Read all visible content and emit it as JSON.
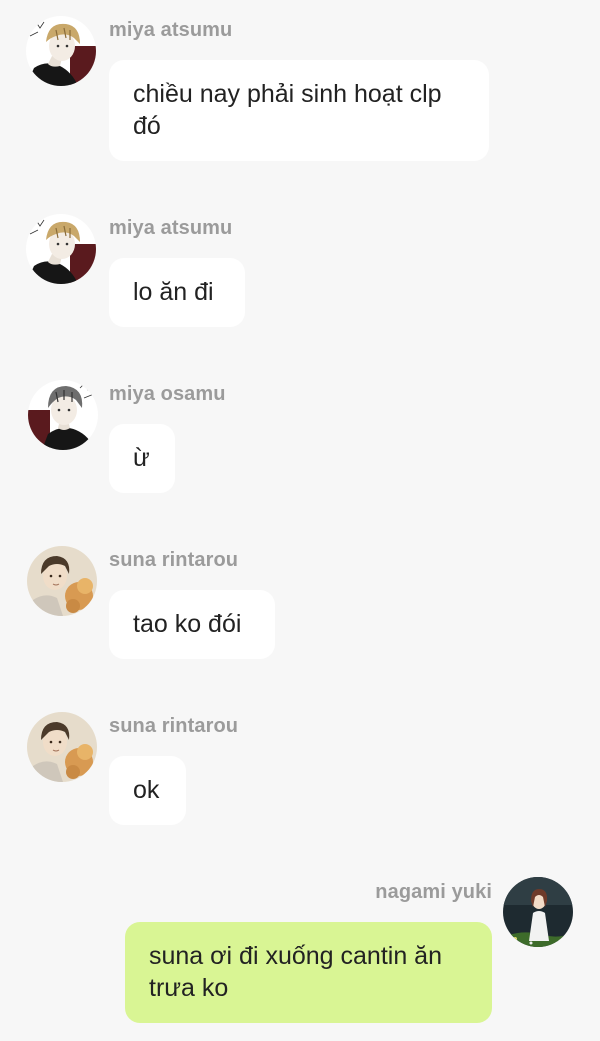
{
  "messages": [
    {
      "sender": "miya atsumu",
      "text": "chiều nay phải sinh hoạt clp đó",
      "avatar": "avatar-atsumu-icon",
      "side": "left"
    },
    {
      "sender": "miya atsumu",
      "text": "lo ăn đi",
      "avatar": "avatar-atsumu-icon",
      "side": "left"
    },
    {
      "sender": "miya osamu",
      "text": "ừ",
      "avatar": "avatar-osamu-icon",
      "side": "left"
    },
    {
      "sender": "suna rintarou",
      "text": "tao ko đói",
      "avatar": "avatar-suna-icon",
      "side": "left"
    },
    {
      "sender": "suna rintarou",
      "text": "ok",
      "avatar": "avatar-suna-icon",
      "side": "left"
    },
    {
      "sender": "nagami yuki",
      "text": "suna ơi đi xuống cantin ăn trưa ko",
      "avatar": "avatar-yuki-icon",
      "side": "right"
    }
  ],
  "colors": {
    "background": "#f7f7f7",
    "bubble_other": "#ffffff",
    "bubble_self": "#d9f594",
    "sender_name": "#9b9b9b",
    "text": "#222222"
  }
}
